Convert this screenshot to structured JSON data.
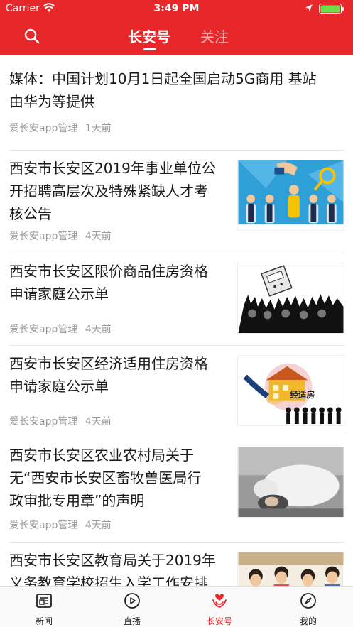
{
  "status_bar": {
    "carrier": "Carrier",
    "time": "3:49 PM"
  },
  "header": {
    "tabs": [
      {
        "label": "长安号",
        "active": true
      },
      {
        "label": "关注",
        "active": false
      }
    ],
    "background_color": "#e8272b"
  },
  "feed": {
    "items": [
      {
        "title_lines": [
          "媒体：中国计划10月1日起全国启动5G商用 基站",
          "由华为等提供"
        ],
        "source": "爱长安app管理",
        "time": "1天前",
        "thumbnail": "none"
      },
      {
        "title_lines": [
          "西安市长安区2019年事业单位公",
          "开招聘高层次及特殊紧缺人才考",
          "核公告"
        ],
        "source": "爱长安app管理",
        "time": "4天前",
        "thumbnail": "recruitment-illustration"
      },
      {
        "title_lines": [
          "西安市长安区限价商品住房资格",
          "申请家庭公示单"
        ],
        "source": "爱长安app管理",
        "time": "4天前",
        "thumbnail": "housing-crowd-illustration"
      },
      {
        "title_lines": [
          "西安市长安区经济适用住房资格",
          "申请家庭公示单"
        ],
        "source": "爱长安app管理",
        "time": "4天前",
        "thumbnail": "affordable-housing-illustration",
        "thumbnail_text": "经适房"
      },
      {
        "title_lines": [
          "西安市长安区农业农村局关于",
          "无“西安市长安区畜牧兽医局行",
          "政审批专用章”的声明"
        ],
        "source": "爱长安app管理",
        "time": "4天前",
        "thumbnail": "sheep-photo"
      },
      {
        "title_lines": [
          "西安市长安区教育局关于2019年",
          "义务教育学校招生入学工作安排"
        ],
        "source": "",
        "time": "",
        "thumbnail": "students-photo"
      }
    ]
  },
  "tabbar": {
    "items": [
      {
        "label": "新闻",
        "icon": "news-icon",
        "active": false
      },
      {
        "label": "直播",
        "icon": "play-icon",
        "active": false
      },
      {
        "label": "长安号",
        "icon": "heart-hands-icon",
        "active": true
      },
      {
        "label": "我的",
        "icon": "compass-icon",
        "active": false
      }
    ],
    "active_color": "#e8272b"
  }
}
